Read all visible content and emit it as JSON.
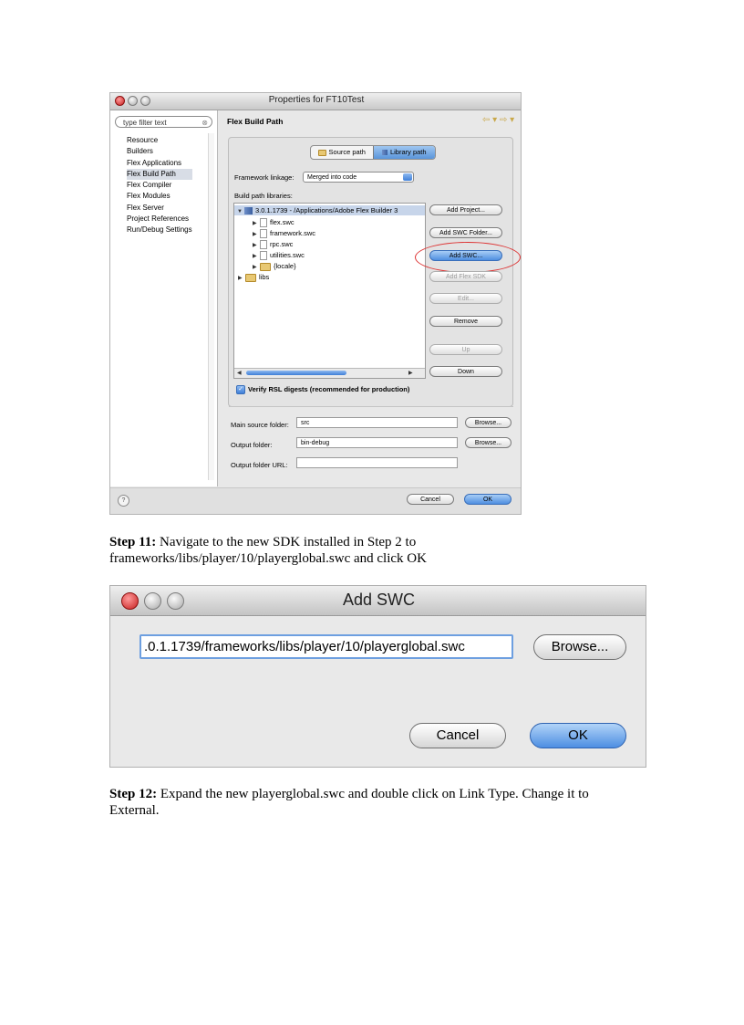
{
  "properties_window": {
    "title": "Properties for FT10Test",
    "filter_placeholder": "type filter text",
    "nav_items": [
      "Resource",
      "Builders",
      "Flex Applications",
      "Flex Build Path",
      "Flex Compiler",
      "Flex Modules",
      "Flex Server",
      "Project References",
      "Run/Debug Settings"
    ],
    "selected_nav": "Flex Build Path",
    "panel_title": "Flex Build Path",
    "nav_arrows": "⇦ ▾ ⇨ ▾",
    "tabs": {
      "source": "Source path",
      "library": "Library path",
      "active": "library"
    },
    "framework_linkage_label": "Framework linkage:",
    "framework_linkage_value": "Merged into code",
    "build_path_label": "Build path libraries:",
    "tree": [
      {
        "label": "3.0.1.1739 - /Applications/Adobe Flex Builder 3",
        "icon": "library-icon",
        "expanded": true
      },
      {
        "label": "flex.swc",
        "icon": "file-icon"
      },
      {
        "label": "framework.swc",
        "icon": "file-icon"
      },
      {
        "label": "rpc.swc",
        "icon": "file-icon"
      },
      {
        "label": "utilities.swc",
        "icon": "file-icon"
      },
      {
        "label": "{locale}",
        "icon": "folder-icon"
      },
      {
        "label": "libs",
        "icon": "folder-icon"
      }
    ],
    "buttons": {
      "add_project": "Add Project...",
      "add_swc_folder": "Add SWC Folder...",
      "add_swc": "Add SWC...",
      "add_flex_sdk": "Add Flex SDK",
      "edit": "Edit...",
      "remove": "Remove",
      "up": "Up",
      "down": "Down",
      "browse": "Browse...",
      "cancel": "Cancel",
      "ok": "OK"
    },
    "verify_rsl": {
      "label": "Verify RSL digests (recommended for production)",
      "checked": true
    },
    "main_source_folder": {
      "label": "Main source folder:",
      "value": "src"
    },
    "output_folder": {
      "label": "Output folder:",
      "value": "bin-debug"
    },
    "output_folder_url": {
      "label": "Output folder URL:",
      "value": ""
    },
    "help_glyph": "?"
  },
  "step11": {
    "prefix": "Step 11:",
    "text": " Navigate to the new SDK installed in Step 2 to frameworks/libs/player/10/playerglobal.swc and click OK"
  },
  "add_swc_dialog": {
    "title": "Add SWC",
    "path_value": ".0.1.1739/frameworks/libs/player/10/playerglobal.swc",
    "browse": "Browse...",
    "cancel": "Cancel",
    "ok": "OK"
  },
  "step12": {
    "prefix": "Step 12:",
    "text": " Expand the new playerglobal.swc and double click on Link Type. Change it to External."
  },
  "colors": {
    "accent_blue": "#4f8fe0",
    "highlight_red": "#dd3333"
  }
}
